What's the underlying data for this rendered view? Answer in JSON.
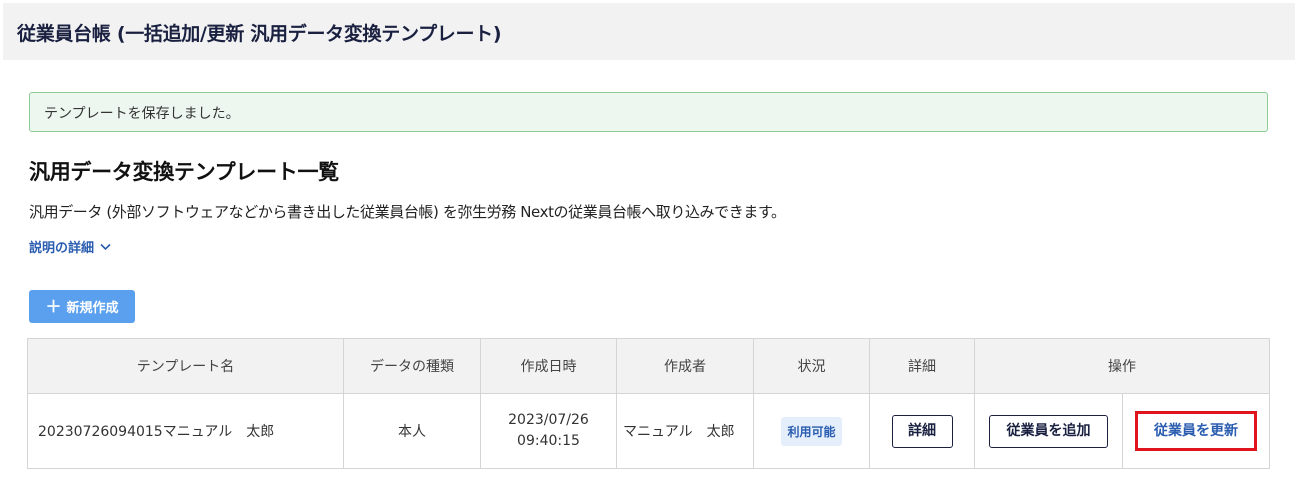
{
  "header": {
    "title": "従業員台帳 (一括追加/更新 汎用データ変換テンプレート)"
  },
  "alert": {
    "message": "テンプレートを保存しました。"
  },
  "section": {
    "title": "汎用データ変換テンプレート一覧",
    "description": "汎用データ (外部ソフトウェアなどから書き出した従業員台帳) を弥生労務 Nextの従業員台帳へ取り込みできます。",
    "details_link": "説明の詳細"
  },
  "toolbar": {
    "new_button": "新規作成",
    "new_icon": "plus-icon"
  },
  "table": {
    "columns": [
      "テンプレート名",
      "データの種類",
      "作成日時",
      "作成者",
      "状況",
      "詳細",
      "操作"
    ],
    "rows": [
      {
        "name": "20230726094015マニュアル　太郎",
        "data_type": "本人",
        "created_date": "2023/07/26",
        "created_time": "09:40:15",
        "creator": "マニュアル　太郎",
        "status": "利用可能",
        "detail_button": "詳細",
        "add_button": "従業員を追加",
        "update_button": "従業員を更新"
      }
    ]
  },
  "colors": {
    "accent": "#5ba0ee",
    "link": "#2a5db0",
    "highlight_border": "#e0141c",
    "alert_bg": "#eef7ef"
  }
}
